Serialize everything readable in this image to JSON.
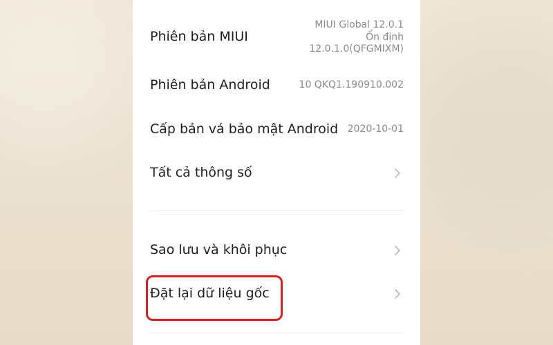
{
  "settings": {
    "miui_version": {
      "label": "Phiên bản MIUI",
      "value_line_1": "MIUI Global 12.0.1",
      "value_line_2": "Ổn định",
      "value_line_3": "12.0.1.0(QFGMIXM)"
    },
    "android_version": {
      "label": "Phiên bản Android",
      "value": "10 QKQ1.190910.002"
    },
    "security_patch": {
      "label": "Cấp bản vá bảo mật Android",
      "value": "2020-10-01"
    },
    "all_specs": {
      "label": "Tất cả thông số",
      "icon": "chevron-right-icon"
    },
    "backup_restore": {
      "label": "Sao lưu và khôi phục",
      "icon": "chevron-right-icon"
    },
    "factory_reset": {
      "label": "Đặt lại dữ liệu gốc",
      "icon": "chevron-right-icon"
    }
  },
  "colors": {
    "background": "#ede3d3",
    "phone_background": "#ffffff",
    "label_text": "#1f1f1f",
    "value_text": "#8a8a8a",
    "chevron": "#b8b8b8",
    "highlight": "#d71f1f",
    "divider": "#ededed"
  }
}
